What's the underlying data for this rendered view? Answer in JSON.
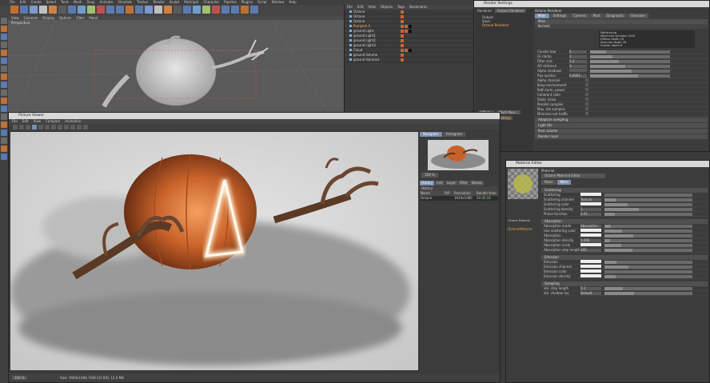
{
  "app": {
    "menu": [
      "File",
      "Edit",
      "Create",
      "Select",
      "Tools",
      "Mesh",
      "Snap",
      "Animate",
      "Simulate",
      "Tracker",
      "Render",
      "Sculpt",
      "MoGraph",
      "Character",
      "Pipeline",
      "Plugins",
      "Script",
      "Window",
      "Help"
    ]
  },
  "viewport": {
    "menu": [
      "View",
      "Cameras",
      "Display",
      "Options",
      "Filter",
      "Panel"
    ],
    "label": "Perspective"
  },
  "object_manager": {
    "menu": [
      "File",
      "Edit",
      "View",
      "Objects",
      "Tags",
      "Bookmarks"
    ],
    "objects": [
      "Octane",
      "Octane",
      "Octane",
      "Pumpkin A",
      "ground Light",
      "ground Light1",
      "ground Light2",
      "ground Light3",
      "Cloud",
      "ground Volume",
      "ground Volume1"
    ]
  },
  "render_settings": {
    "title": "Render Settings",
    "renderer_label": "Renderer",
    "renderer_value": "Octane Renderer",
    "left_items": [
      "Output",
      "Save",
      "Octane Renderer"
    ],
    "bottom_buttons": [
      "Effect...",
      "Multi-Pass...",
      "My Render Setting"
    ],
    "header": "Octane Renderer",
    "tabs": [
      "Main",
      "Settings",
      "Camera",
      "Post",
      "Diagnostic",
      "Denoiser"
    ],
    "sub_tab": "Main",
    "section": "Kernels",
    "kernel_info": [
      "Pathtracing",
      "Maximum samples  1000",
      "Diffuse depth  16",
      "Specular depth  16",
      "Scatter depth  8"
    ],
    "params": [
      {
        "label": "Caustic blur",
        "value": "0"
      },
      {
        "label": "GI clamp",
        "value": "1"
      },
      {
        "label": "Filter size",
        "value": "1.2"
      },
      {
        "label": "AO distance",
        "value": "3"
      },
      {
        "label": "Alpha shadows",
        "value": ""
      },
      {
        "label": "Ray epsilon",
        "value": "0.0001"
      }
    ],
    "options": [
      "Alpha channel",
      "Keep environment",
      "Path term. power",
      "Coherent ratio",
      "Static noise",
      "Parallel samples",
      "Max. tile samples",
      "Minimize net traffic"
    ],
    "bottom_sections": [
      "Adaptive sampling",
      "Light IDs",
      "Post volume",
      "Render layer"
    ]
  },
  "picture_viewer": {
    "title": "Picture Viewer",
    "menu": [
      "File",
      "Edit",
      "View",
      "Compare",
      "Animation"
    ],
    "nav_tabs": [
      "Navigator",
      "Histogram"
    ],
    "zoom": "100 %",
    "lower_tabs": [
      "History",
      "Info",
      "Layer",
      "Filter",
      "Stereo"
    ],
    "history_header": "History",
    "history_cols": [
      "Name",
      "R/P",
      "Resolution",
      "Render time"
    ],
    "history_row": [
      "Octane",
      "",
      "1920x1080",
      "00:00:26"
    ],
    "status": "Size: 1920x1080, RGB (32 Bit), 12.4 MB",
    "zoom_field": "100 %"
  },
  "material_editor": {
    "title": "Material Editor",
    "mat_name": "Octane Material",
    "mat_label": "Material",
    "swatch_label": "OctaneMaterial",
    "header_btn": "Octane Material Editor",
    "tabs": [
      "Basic",
      "Main"
    ],
    "sections": [
      {
        "name": "Scattering",
        "rows": [
          {
            "label": "Scattering",
            "value": ""
          },
          {
            "label": "Scattering channel",
            "value": "Texture"
          },
          {
            "label": "Scattering color",
            "value": ""
          },
          {
            "label": "Scattering density",
            "value": "1"
          },
          {
            "label": "Phase function",
            "value": "0.01"
          }
        ]
      },
      {
        "name": "Absorption",
        "rows": [
          {
            "label": "Absorption mode",
            "value": "Absorption"
          },
          {
            "label": "Use scattering color",
            "value": ""
          },
          {
            "label": "Absorption",
            "value": ""
          },
          {
            "label": "Absorption density",
            "value": "0.006"
          },
          {
            "label": "Absorption scale",
            "value": ""
          },
          {
            "label": "Absorption step length",
            "value": "100"
          }
        ]
      },
      {
        "name": "Emission",
        "rows": [
          {
            "label": "Emission",
            "value": ""
          },
          {
            "label": "Emission channel",
            "value": ""
          },
          {
            "label": "Emission color",
            "value": ""
          },
          {
            "label": "Emission density",
            "value": ""
          }
        ]
      },
      {
        "name": "Sampling",
        "rows": [
          {
            "label": "Vol. step length",
            "value": "0.1"
          },
          {
            "label": "Vol. shadow ray",
            "value": "Default"
          }
        ]
      }
    ]
  },
  "colors": {
    "accent": "#7b8fb0",
    "panel_bg": "#3c3c3c",
    "title_bg": "#d8d8d8",
    "pumpkin": "#c8622a"
  }
}
